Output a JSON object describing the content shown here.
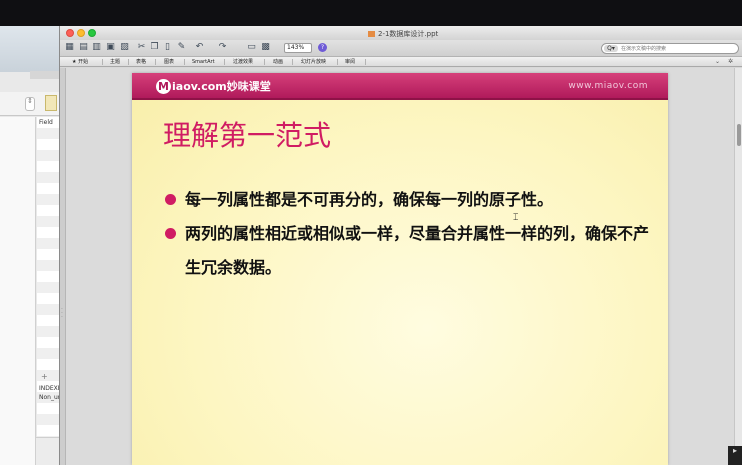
{
  "background_app": {
    "field_label": "Field",
    "index_label": "INDEXE",
    "non_unique_label": "Non_un",
    "plus": "+",
    "stepper": "⇕"
  },
  "window": {
    "title": "2-1数据库设计.ppt"
  },
  "toolbar": {
    "zoom_value": "143%",
    "help": "?",
    "search_button": "Q▾",
    "search_placeholder": "在演示文稿中的搜索"
  },
  "ribbon": {
    "tabs": [
      "开始",
      "主题",
      "表格",
      "图表",
      "SmartArt",
      "过渡效果",
      "动画",
      "幻灯片放映",
      "审阅"
    ],
    "collapse": "⌄",
    "settings": "✲"
  },
  "slide": {
    "logo_badge": "M",
    "logo_text": "iaov.com妙味课堂",
    "url": "www.miaov.com",
    "title": "理解第一范式",
    "bullets": [
      "每一列属性都是不可再分的，确保每一列的原子性。",
      "两列的属性相近或相似或一样，尽量合并属性一样的列，确保不产生冗余数据。"
    ]
  },
  "colors": {
    "accent": "#d01c63",
    "header_band": "#b01a5b",
    "slide_bg": "#fdf6c2"
  }
}
